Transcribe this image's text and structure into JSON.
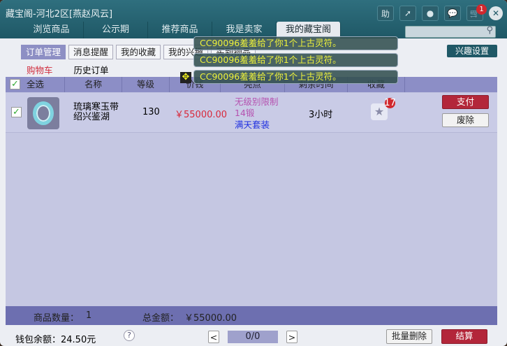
{
  "window": {
    "title": "藏宝阁-河北2区[燕赵风云]",
    "cart_badge": "1",
    "help_label": "助"
  },
  "tabs": [
    "浏览商品",
    "公示期",
    "推荐商品",
    "我是卖家",
    "我的藏宝阁"
  ],
  "subtabs": [
    "订单管理",
    "消息提醒",
    "我的收藏",
    "我的兴趣",
    "买到物品"
  ],
  "interest_button": "兴趣设置",
  "cart_tabs": [
    "购物车",
    "历史订单"
  ],
  "table": {
    "headers": [
      "全选",
      "名称",
      "等级",
      "价钱",
      "亮点",
      "剩余时间",
      "收藏"
    ],
    "rows": [
      {
        "name": "琉璃寒玉带\n绍兴鉴湖",
        "level": "130",
        "price": "￥55000.00",
        "highlight1": "无级别限制",
        "highlight2": "14锻",
        "highlight3": "满天套装",
        "time": "3小时",
        "fav_count": "17",
        "pay": "支付",
        "discard": "废除"
      }
    ]
  },
  "toasts": [
    "CC90096羞羞给了你1个上古灵符。",
    "CC90096羞羞给了你1个上古灵符。",
    "CC90096羞羞给了你1个上古灵符。"
  ],
  "summary": {
    "count_label": "商品数量：",
    "count": "1",
    "total_label": "总金额：",
    "total": "￥55000.00"
  },
  "footer": {
    "wallet": "钱包余额：24.50元",
    "help": "?",
    "page": "0/0",
    "prev": "<",
    "next": ">",
    "batch_delete": "批量删除",
    "checkout": "结算"
  }
}
